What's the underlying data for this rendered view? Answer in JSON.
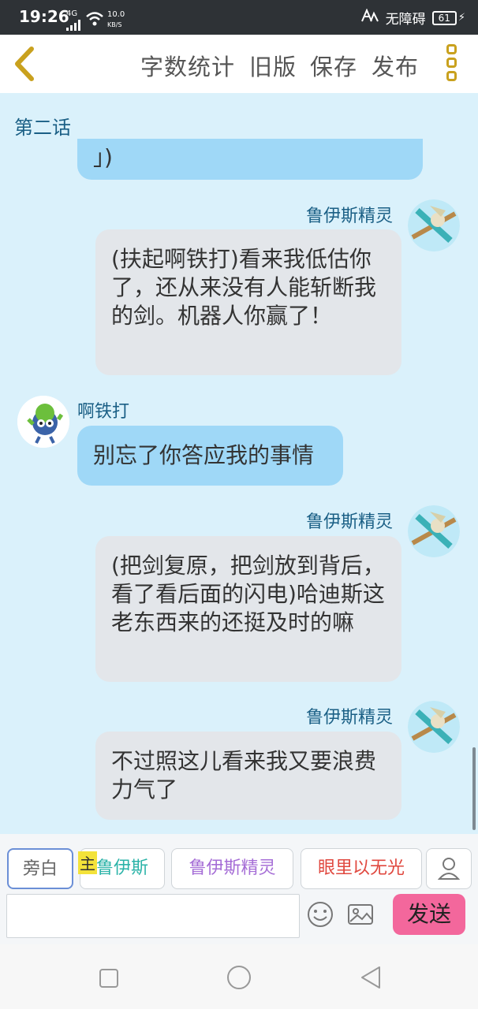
{
  "status_bar": {
    "time": "19:26",
    "network": "4G",
    "speed_value": "10.0",
    "speed_unit": "KB/S",
    "accessibility": "无障碍",
    "battery": "61"
  },
  "toolbar": {
    "back_icon": "chevron-left-icon",
    "word_count": "字数统计",
    "old_version": "旧版",
    "save": "保存",
    "publish": "发布",
    "more_icon": "more-vertical-icon"
  },
  "chapter_title": "第二话",
  "messages": [
    {
      "speaker": "",
      "text": "」)",
      "side": "left",
      "style": "blue"
    },
    {
      "speaker": "鲁伊斯精灵",
      "text": "(扶起啊铁打)看来我低估你了，还从来没有人能斩断我的剑。机器人你赢了！",
      "side": "right",
      "style": "grey"
    },
    {
      "speaker": "啊铁打",
      "text": "别忘了你答应我的事情",
      "side": "left",
      "style": "blue"
    },
    {
      "speaker": "鲁伊斯精灵",
      "text": "(把剑复原，把剑放到背后，看了看后面的闪电)哈迪斯这老东西来的还挺及时的嘛",
      "side": "right",
      "style": "grey"
    },
    {
      "speaker": "鲁伊斯精灵",
      "text": "不过照这儿看来我又要浪费力气了",
      "side": "right",
      "style": "grey"
    }
  ],
  "composer": {
    "roles": [
      {
        "label": "旁白",
        "color": "#666666"
      },
      {
        "label": "鲁伊斯",
        "color": "#2bb3a8",
        "badge": "主"
      },
      {
        "label": "鲁伊斯精灵",
        "color": "#a56dd6"
      },
      {
        "label": "眼里以无光",
        "color": "#e0483f"
      }
    ],
    "input_value": "",
    "send_label": "发送",
    "colors": {
      "send_bg": "#f3679c"
    }
  }
}
